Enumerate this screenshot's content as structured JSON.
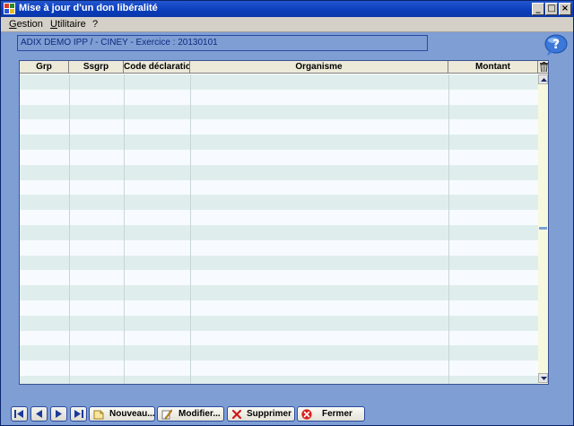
{
  "window": {
    "title": "Mise à jour d'un don libéralité",
    "minimize": "_",
    "maximize": "□",
    "close": "×"
  },
  "menu": [
    "Gestion",
    "Utilitaire",
    "?"
  ],
  "context_line": "ADIX DEMO IPP /    - CINEY - Exercice : 20130101",
  "grid": {
    "columns": [
      "Grp",
      "Ssgrp",
      "Code déclaration",
      "Organisme",
      "Montant"
    ],
    "rows": []
  },
  "toolbar": {
    "nav": [
      "first-record-icon",
      "previous-record-icon",
      "next-record-icon",
      "last-record-icon"
    ],
    "new_label": "Nouveau...",
    "modify_label": "Modifier...",
    "delete_label": "Supprimer",
    "close_label": "Fermer"
  },
  "colors": {
    "background": "#7e9ed4",
    "titlebar": "#0a3dbb",
    "row_odd": "#dfeeec",
    "row_even": "#f7fbff"
  }
}
